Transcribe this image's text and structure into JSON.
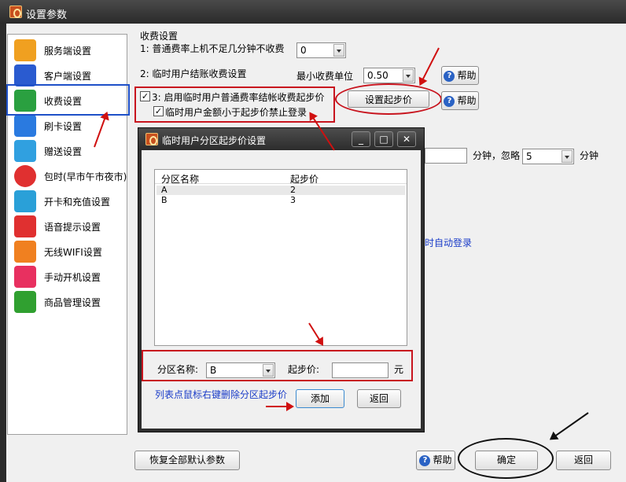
{
  "window": {
    "title": "设置参数"
  },
  "sidebar": {
    "items": [
      {
        "label": "服务端设置",
        "icon": "server-icon",
        "color": "#f0a020"
      },
      {
        "label": "客户端设置",
        "icon": "monitor-icon",
        "color": "#2a5bd0"
      },
      {
        "label": "收费设置",
        "icon": "billing-clock-icon",
        "color": "#f5c800"
      },
      {
        "label": "刷卡设置",
        "icon": "card-icon",
        "color": "#2a7ae0"
      },
      {
        "label": "赠送设置",
        "icon": "gift-icon",
        "color": "#30a0e0"
      },
      {
        "label": "包时(早市午市夜市)",
        "icon": "timer-icon",
        "color": "#e03030"
      },
      {
        "label": "开卡和充值设置",
        "icon": "id-card-icon",
        "color": "#2aa0d8"
      },
      {
        "label": "语音提示设置",
        "icon": "microphone-icon",
        "color": "#e03030"
      },
      {
        "label": "无线WIFI设置",
        "icon": "wifi-icon",
        "color": "#f08020"
      },
      {
        "label": "手动开机设置",
        "icon": "hand-pointer-icon",
        "color": "#e83060"
      },
      {
        "label": "商品管理设置",
        "icon": "cart-icon",
        "color": "#30a030"
      }
    ]
  },
  "billing": {
    "section_title": "收费设置",
    "rule1_label": "1: 普通费率上机不足几分钟不收费",
    "rule1_value": "0",
    "rule2_label": "2: 临时用户结账收费设置",
    "min_unit_label": "最小收费单位",
    "min_unit_value": "0.50",
    "help_label": "帮助",
    "rule3_label": "3: 启用临时用户普通费率结帐收费起步价",
    "rule3_sub_label": "临时用户金额小于起步价禁止登录",
    "set_start_price_label": "设置起步价",
    "hidden_row_fragment": "分钟，忽略",
    "ignore_value": "5",
    "minute_label": "分钟",
    "auto_login_fragment": "时自动登录"
  },
  "dialog": {
    "title": "临时用户分区起步价设置",
    "columns": [
      "分区名称",
      "起步价"
    ],
    "rows": [
      {
        "name": "A",
        "price": "2"
      },
      {
        "name": "B",
        "price": "3"
      }
    ],
    "zone_label": "分区名称:",
    "zone_value": "B",
    "price_label": "起步价:",
    "price_value": "",
    "unit": "元",
    "hint": "列表点鼠标右键删除分区起步价",
    "add_label": "添加",
    "back_label": "返回"
  },
  "footer": {
    "restore_label": "恢复全部默认参数",
    "help_label": "帮助",
    "ok_label": "确定",
    "back_label": "返回"
  },
  "colors": {
    "annotation_red": "#c8141e",
    "link_blue": "#1a3cc8",
    "selection_blue": "#1e50c8"
  }
}
